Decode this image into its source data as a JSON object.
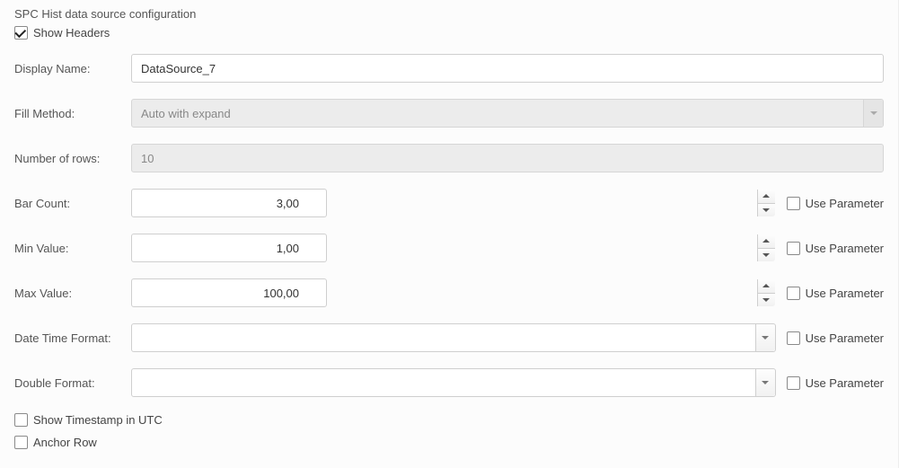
{
  "title": "SPC Hist data source configuration",
  "showHeaders": {
    "label": "Show Headers",
    "checked": true
  },
  "displayName": {
    "label": "Display Name:",
    "value": "DataSource_7"
  },
  "fillMethod": {
    "label": "Fill Method:",
    "value": "Auto with expand",
    "disabled": true
  },
  "numberOfRows": {
    "label": "Number of rows:",
    "value": "10",
    "disabled": true
  },
  "barCount": {
    "label": "Bar Count:",
    "value": "3,00",
    "useParamLabel": "Use Parameter",
    "useParamChecked": false
  },
  "minValue": {
    "label": "Min Value:",
    "value": "1,00",
    "useParamLabel": "Use Parameter",
    "useParamChecked": false
  },
  "maxValue": {
    "label": "Max Value:",
    "value": "100,00",
    "useParamLabel": "Use Parameter",
    "useParamChecked": false
  },
  "dateTimeFormat": {
    "label": "Date Time Format:",
    "value": "",
    "useParamLabel": "Use Parameter",
    "useParamChecked": false
  },
  "doubleFormat": {
    "label": "Double Format:",
    "value": "",
    "useParamLabel": "Use Parameter",
    "useParamChecked": false
  },
  "showTimestampUtc": {
    "label": "Show Timestamp in UTC",
    "checked": false
  },
  "anchorRow": {
    "label": "Anchor Row",
    "checked": false
  }
}
